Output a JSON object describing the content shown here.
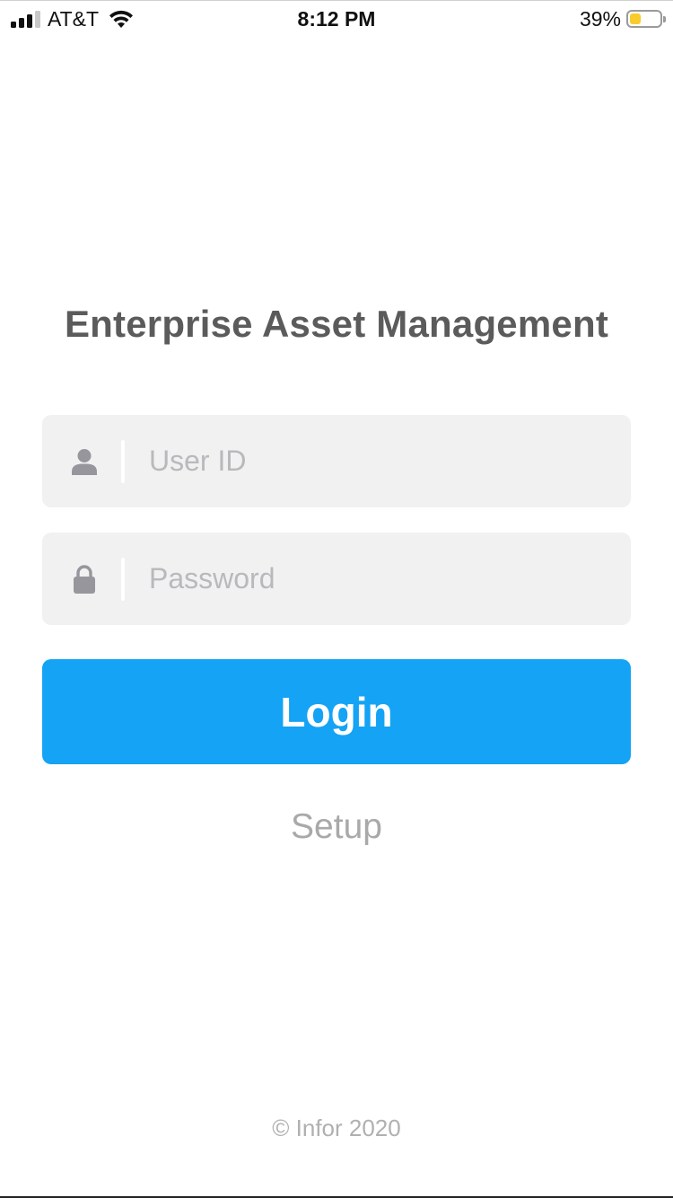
{
  "status_bar": {
    "carrier": "AT&T",
    "time": "8:12 PM",
    "battery_percent": "39%",
    "battery_level": 0.39,
    "battery_color": "#f7cc2c",
    "icons": [
      "signal-icon",
      "wifi-icon",
      "battery-icon"
    ]
  },
  "app": {
    "title": "Enterprise Asset Management"
  },
  "login_form": {
    "user_id": {
      "icon": "user-icon",
      "placeholder": "User ID",
      "value": ""
    },
    "password": {
      "icon": "lock-icon",
      "placeholder": "Password",
      "value": ""
    },
    "login_label": "Login",
    "login_color": "#14a3f5",
    "setup_label": "Setup"
  },
  "footer": {
    "copyright": "© Infor 2020"
  },
  "colors": {
    "field_background": "#f1f1f1",
    "title_text": "#5b5b5b",
    "placeholder_text": "#b9b9bd",
    "icon": "#96969c"
  }
}
